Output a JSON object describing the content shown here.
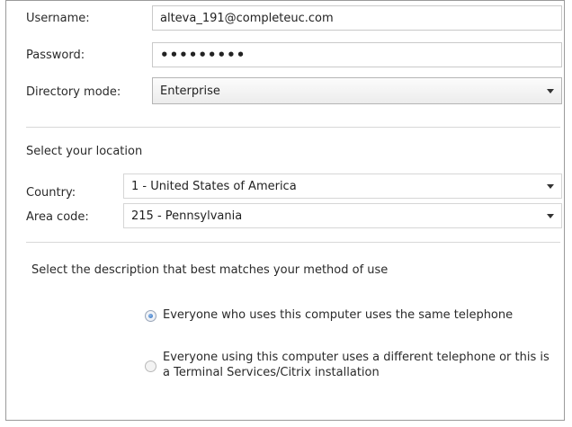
{
  "account": {
    "username_label": "Username:",
    "username_value": "alteva_191@completeuc.com",
    "password_label": "Password:",
    "password_value": "•••••••••",
    "directory_label": "Directory mode:",
    "directory_value": "Enterprise"
  },
  "location": {
    "section_title": "Select your location",
    "country_label": "Country:",
    "country_value": "1 - United States of America",
    "area_label": "Area code:",
    "area_value": "215 - Pennsylvania"
  },
  "usage": {
    "section_title": "Select the description that best matches your method of use",
    "options": [
      {
        "label": "Everyone who uses this computer uses the same telephone",
        "checked": true
      },
      {
        "label_line1": "Everyone using this computer uses a different telephone or this is",
        "label_line2": "a Terminal Services/Citrix installation",
        "checked": false
      }
    ]
  },
  "icons": {
    "dropdown": "chevron-down-icon"
  }
}
